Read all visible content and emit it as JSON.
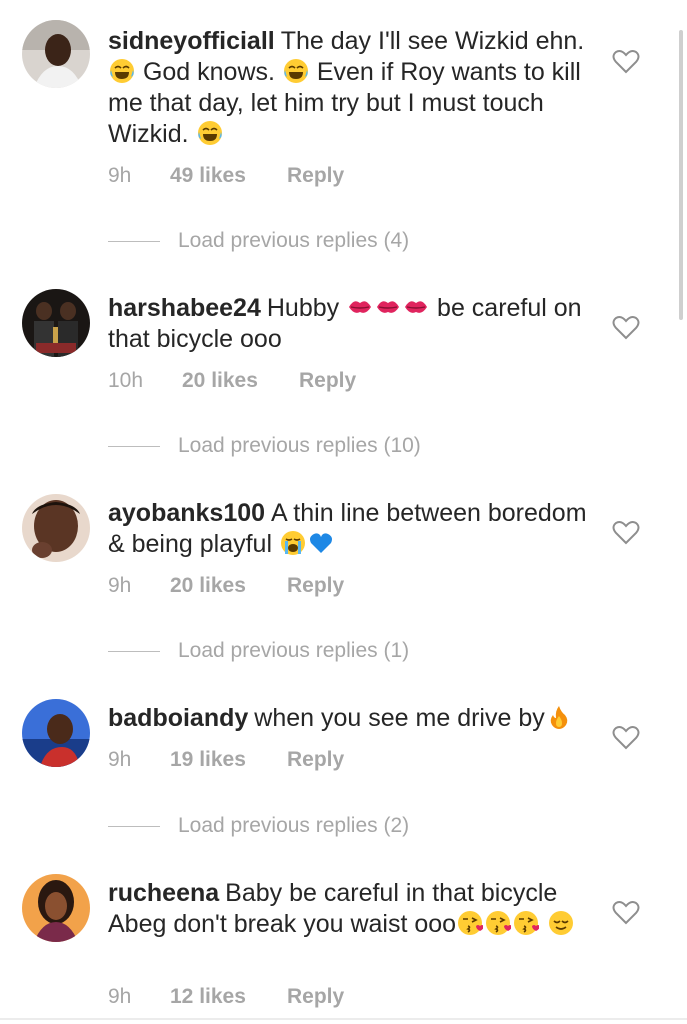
{
  "comments": [
    {
      "username": "sidneyofficiall",
      "text_parts": [
        "The day I'll see Wizkid ehn.",
        " God knows. ",
        " Even if Roy wants to kill me that day, let him try but I must touch Wizkid. "
      ],
      "time": "9h",
      "likes": "49 likes",
      "reply": "Reply",
      "load_replies": "Load previous replies (4)",
      "emoji": "face-with-tears-of-joy"
    },
    {
      "username": "harshabee24",
      "text_parts": [
        "Hubby ",
        " be careful on that bicycle ooo"
      ],
      "time": "10h",
      "likes": "20 likes",
      "reply": "Reply",
      "load_replies": "Load previous replies (10)",
      "emoji": "kiss-mark"
    },
    {
      "username": "ayobanks100",
      "text_parts": [
        "A thin line between boredom & being playful "
      ],
      "time": "9h",
      "likes": "20 likes",
      "reply": "Reply",
      "load_replies": "Load previous replies (1)",
      "emoji": "loudly-crying-face blue-heart"
    },
    {
      "username": "badboiandy",
      "text_parts": [
        "when you see me drive by"
      ],
      "time": "9h",
      "likes": "19 likes",
      "reply": "Reply",
      "load_replies": "Load previous replies (2)",
      "emoji": "fire"
    },
    {
      "username": "rucheena",
      "text_parts": [
        "Baby be careful in that bicycle Abeg don't break you waist ooo"
      ],
      "time": "9h",
      "likes": "12 likes",
      "reply": "Reply",
      "emoji": "face-blowing-a-kiss relieved-face"
    }
  ],
  "colors": {
    "text": "#262626",
    "muted": "#a6a6a6",
    "divider": "#bdbdbd"
  }
}
